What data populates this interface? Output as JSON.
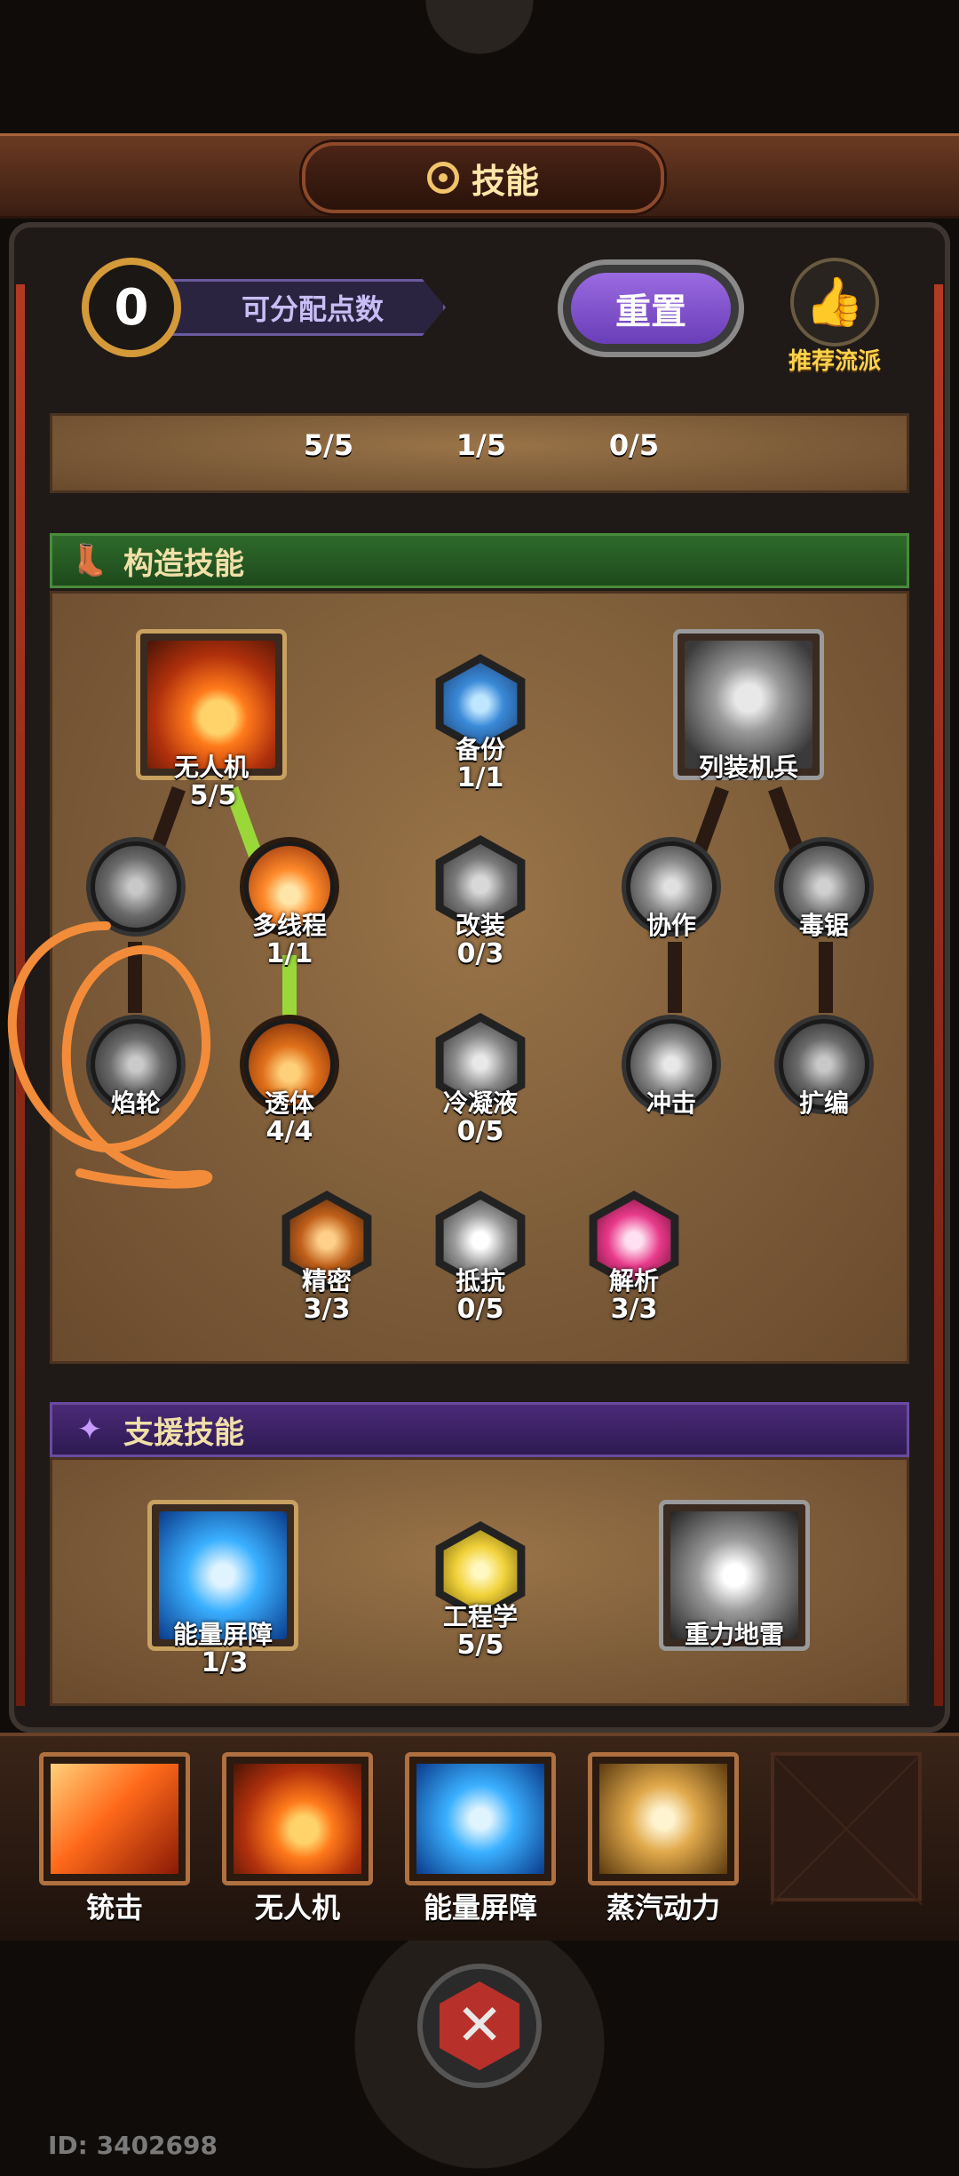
{
  "header": {
    "title": "技能"
  },
  "toolbar": {
    "points_value": "0",
    "points_label": "可分配点数",
    "reset_label": "重置",
    "recommend_label": "推荐流派"
  },
  "top_row_values": [
    "5/5",
    "1/5",
    "0/5"
  ],
  "build_section": {
    "title": "构造技能",
    "nodes": [
      {
        "label": "无人机",
        "value": "5/5"
      },
      {
        "label": "备份",
        "value": "1/1"
      },
      {
        "label": "列装机兵",
        "value": ""
      },
      {
        "label": "多线程",
        "value": "1/1"
      },
      {
        "label": "改装",
        "value": "0/3"
      },
      {
        "label": "协作",
        "value": ""
      },
      {
        "label": "毒锯",
        "value": ""
      },
      {
        "label": "焰轮",
        "value": ""
      },
      {
        "label": "透体",
        "value": "4/4"
      },
      {
        "label": "冷凝液",
        "value": "0/5"
      },
      {
        "label": "冲击",
        "value": ""
      },
      {
        "label": "扩编",
        "value": ""
      },
      {
        "label": "精密",
        "value": "3/3"
      },
      {
        "label": "抵抗",
        "value": "0/5"
      },
      {
        "label": "解析",
        "value": "3/3"
      }
    ]
  },
  "support_section": {
    "title": "支援技能",
    "nodes": [
      {
        "label": "能量屏障",
        "value": "1/3"
      },
      {
        "label": "工程学",
        "value": "5/5"
      },
      {
        "label": "重力地雷",
        "value": ""
      }
    ]
  },
  "equipped": [
    "铳击",
    "无人机",
    "能量屏障",
    "蒸汽动力"
  ],
  "footer": {
    "id": "ID: 3402698"
  },
  "colors": {
    "accent_gold": "#d49a3a",
    "build_green": "#2e6a2a",
    "support_purple": "#4a2a78",
    "annotation_orange": "#f28c3a"
  }
}
